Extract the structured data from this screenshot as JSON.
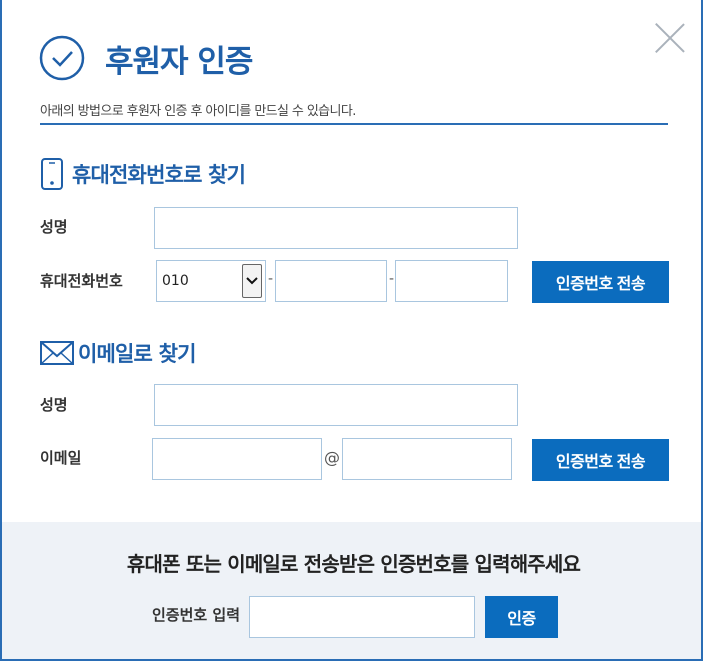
{
  "header": {
    "title": "후원자 인증",
    "subtitle": "아래의 방법으로 후원자 인증 후 아이디를 만드실 수 있습니다."
  },
  "phone_section": {
    "title": "휴대전화번호로 찾기",
    "name_label": "성명",
    "name_value": "",
    "phone_label": "휴대전화번호",
    "phone_prefix": "010",
    "phone_mid": "",
    "phone_last": "",
    "separator": "-",
    "send_button": "인증번호 전송"
  },
  "email_section": {
    "title": "이메일로 찾기",
    "name_label": "성명",
    "name_value": "",
    "email_label": "이메일",
    "email_id": "",
    "at_symbol": "@",
    "email_domain": "",
    "send_button": "인증번호 전송"
  },
  "verify": {
    "message": "휴대폰 또는 이메일로 전송받은 인증번호를 입력해주세요",
    "code_label": "인증번호 입력",
    "code_value": "",
    "verify_button": "인증"
  },
  "colors": {
    "accent": "#1f5fa8",
    "button": "#0b6cbe",
    "bottom_bg": "#eef2f7"
  }
}
